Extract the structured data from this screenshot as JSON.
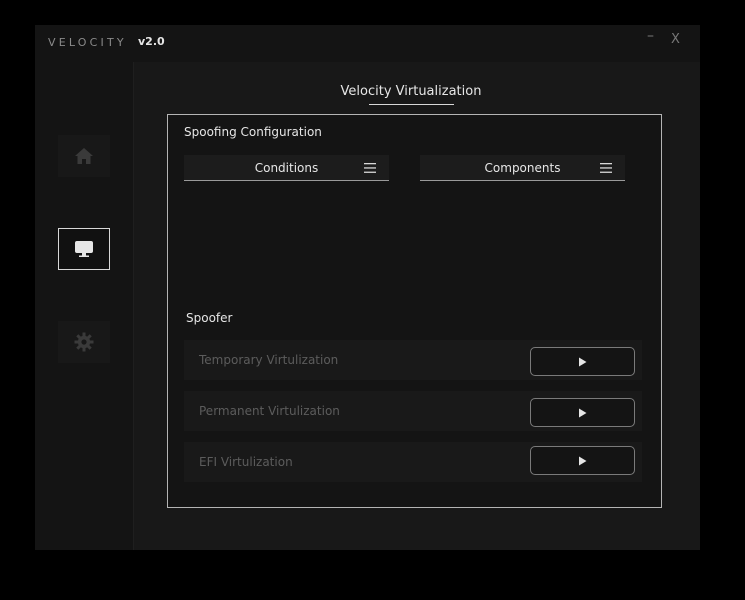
{
  "window": {
    "app_name": "VELOCITY",
    "version": "v2.0",
    "minimize_label": "–",
    "close_label": "X"
  },
  "sidebar": {
    "items": [
      {
        "name": "home",
        "icon": "home-icon",
        "active": false
      },
      {
        "name": "virtualization",
        "icon": "monitor-icon",
        "active": true
      },
      {
        "name": "settings",
        "icon": "gear-icon",
        "active": false
      }
    ]
  },
  "main": {
    "title": "Velocity Virtualization",
    "config_title": "Spoofing Configuration",
    "conditions_label": "Conditions",
    "components_label": "Components",
    "spoofer_title": "Spoofer",
    "spoofer_rows": [
      {
        "label": "Temporary Virtulization",
        "button_icon": "play-icon"
      },
      {
        "label": "Permanent Virtulization",
        "button_icon": "play-icon"
      },
      {
        "label": "EFI Virtulization",
        "button_icon": "play-icon"
      }
    ]
  },
  "colors": {
    "background": "#141414",
    "panel_border": "#b4b4b4",
    "text": "#e6e6e6",
    "muted_text": "#5c5c5c"
  }
}
